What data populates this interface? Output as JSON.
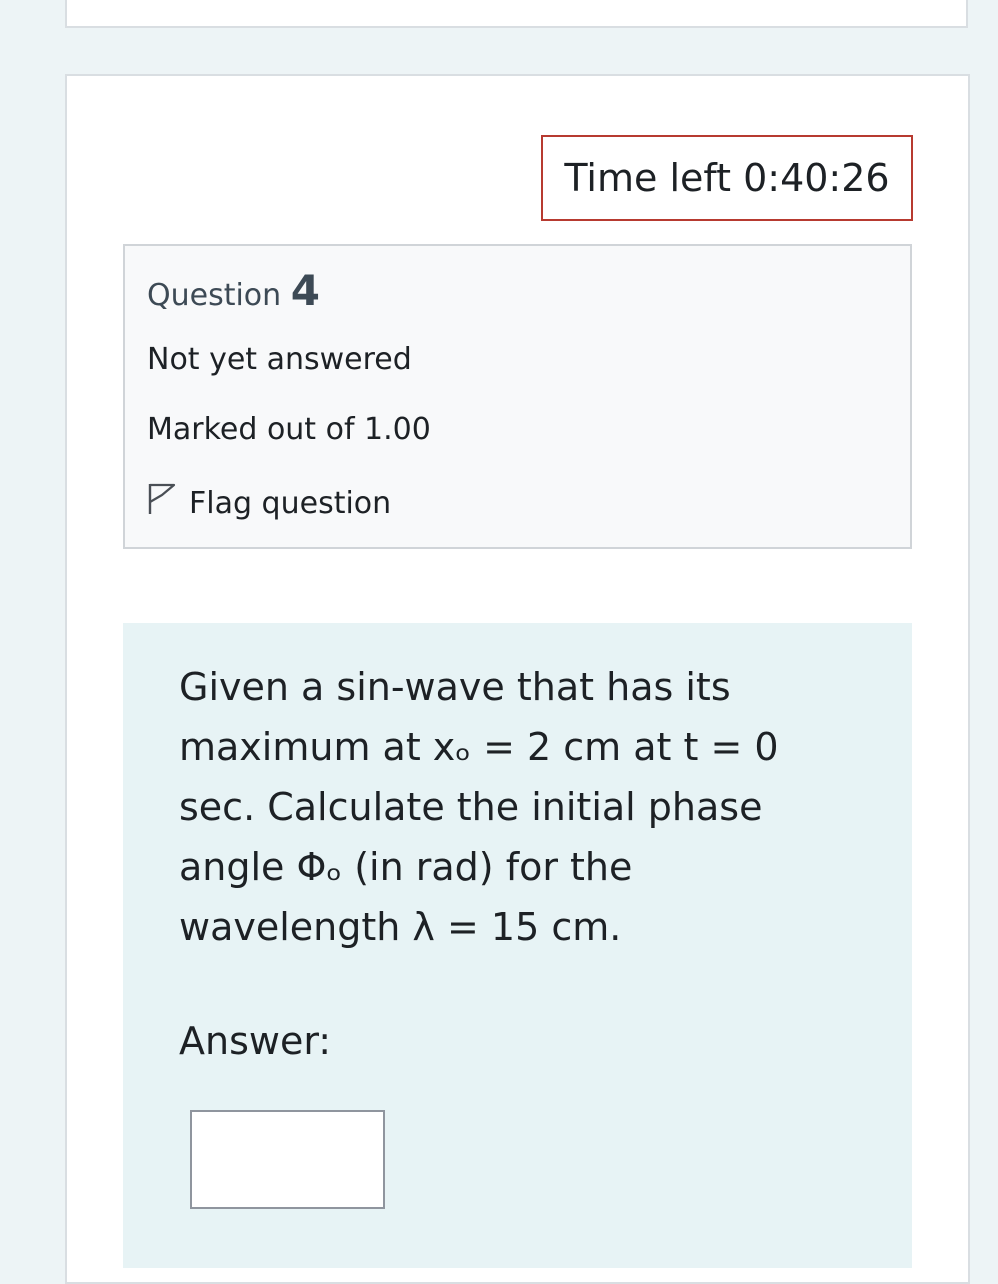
{
  "timer": {
    "label": "Time left 0:40:26"
  },
  "question_info": {
    "label": "Question",
    "number": "4",
    "state": "Not yet answered",
    "grade": "Marked out of 1.00",
    "flag_label": "Flag question",
    "flag_icon": "flag-outline-icon"
  },
  "question": {
    "line1": "Given a sin-wave that has its",
    "line2": "maximum at xₒ = 2 cm at t = 0",
    "line3": "sec. Calculate the initial phase",
    "line4": "angle Φₒ (in rad) for the",
    "line5": "wavelength λ = 15 cm.",
    "answer_label": "Answer:",
    "answer_value": ""
  }
}
